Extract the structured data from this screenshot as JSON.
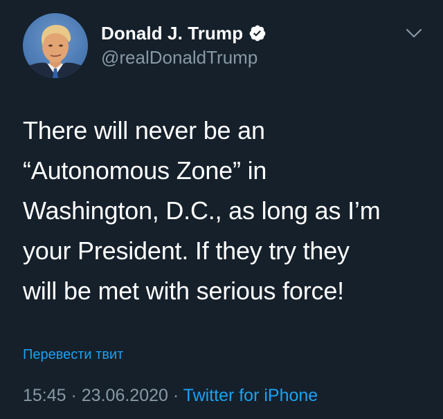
{
  "tweet": {
    "author": {
      "display_name": "Donald J. Trump",
      "handle": "@realDonaldTrump",
      "verified_icon": "verified-badge-icon",
      "avatar": "profile-avatar"
    },
    "menu_icon": "chevron-down-icon",
    "text": "There will never be an\n“Autonomous Zone” in\nWashington, D.C., as long as I’m\nyour President. If they try they\nwill be met with serious force!",
    "translate_label": "Перевести твит",
    "time": "15:45",
    "separator1": " · ",
    "date": "23.06.2020",
    "separator2": " · ",
    "source": "Twitter for iPhone"
  },
  "colors": {
    "background": "#15202b",
    "primary_text": "#ffffff",
    "secondary_text": "#8899a6",
    "accent": "#1da1f2"
  }
}
